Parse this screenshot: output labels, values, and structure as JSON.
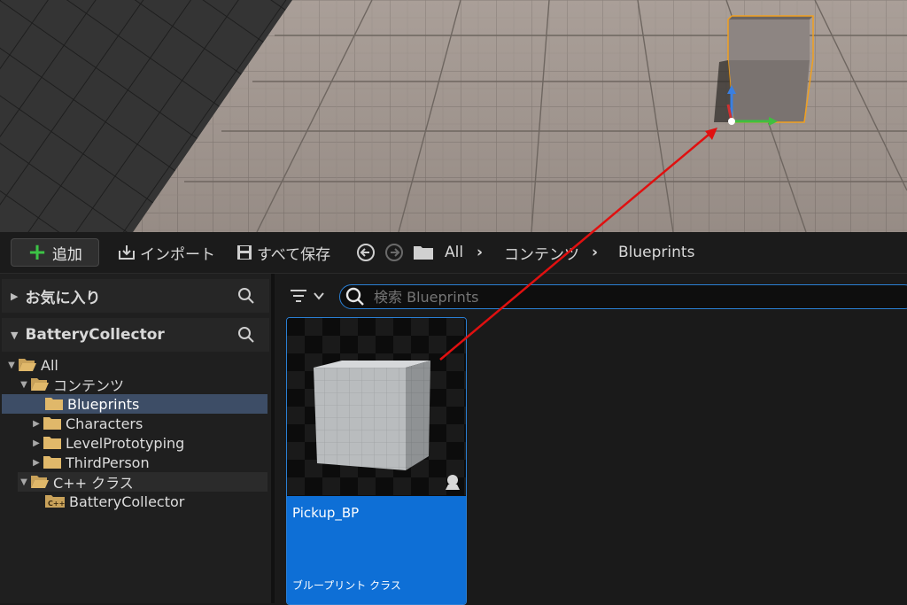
{
  "toolbar": {
    "add_label": "追加",
    "import_label": "インポート",
    "save_all_label": "すべて保存",
    "breadcrumb": [
      "All",
      "コンテンツ",
      "Blueprints"
    ]
  },
  "sidebar": {
    "favorites_label": "お気に入り",
    "project_label": "BatteryCollector",
    "tree": {
      "all": "All",
      "content": "コンテンツ",
      "blueprints": "Blueprints",
      "characters": "Characters",
      "level_prototyping": "LevelPrototyping",
      "third_person": "ThirdPerson",
      "cpp_classes": "C++ クラス",
      "cpp_battery": "BatteryCollector"
    }
  },
  "search": {
    "placeholder": "検索 Blueprints"
  },
  "asset": {
    "name": "Pickup_BP",
    "type": "ブループリント クラス"
  },
  "colors": {
    "accent": "#0e6fd6",
    "selection": "#3d4d66",
    "add_plus": "#3cc346",
    "arrow": "#e01010"
  }
}
